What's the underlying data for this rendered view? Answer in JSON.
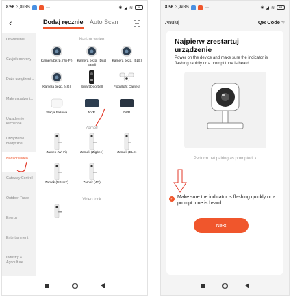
{
  "colors": {
    "accent": "#f0562c",
    "annotation_red": "#e33a2a"
  },
  "left": {
    "status": {
      "time": "8:56",
      "speed": "3,8kB/s",
      "more": "···",
      "battery": "68"
    },
    "header": {
      "back_icon": "chevron-left-icon",
      "tab_manual": "Dodaj ręcznie",
      "tab_auto": "Auto Scan",
      "scan_icon": "scan-frame-icon"
    },
    "sidebar": [
      {
        "label": "Oświetlenie"
      },
      {
        "label": "Czujnik ochrony"
      },
      {
        "label": "Duże urządzeni..."
      },
      {
        "label": "Małe urządzeni..."
      },
      {
        "label": "Urządzenie kuchenne"
      },
      {
        "label": "Urządzenie medyczne..."
      },
      {
        "label": "Nadzór wideo",
        "active": true
      },
      {
        "label": "Gateway Control"
      },
      {
        "label": "Outdoor Travel"
      },
      {
        "label": "Energy"
      },
      {
        "label": "Entertainment"
      },
      {
        "label": "Industry & Agriculture"
      }
    ],
    "sections": {
      "video": {
        "title": "Nadzór wideo",
        "items": [
          {
            "label": "Kamera bezp. (Wi-Fi)",
            "icon": "camera-icon"
          },
          {
            "label": "Kamera bezp. (Dual Band)",
            "icon": "camera-icon"
          },
          {
            "label": "Kamera bezp. (BLE)",
            "icon": "camera-icon"
          },
          {
            "label": "Kamera bezp. (4G)",
            "icon": "camera-icon"
          },
          {
            "label": "Smart Doorbell",
            "icon": "doorbell-icon"
          },
          {
            "label": "Floodlight Camera",
            "icon": "floodlight-icon"
          },
          {
            "label": "Stacja bazowa",
            "icon": "base-station-icon"
          },
          {
            "label": "NVR",
            "icon": "nvr-icon"
          },
          {
            "label": "DVR",
            "icon": "dvr-icon"
          }
        ]
      },
      "lock": {
        "title": "Zamek",
        "items": [
          {
            "label": "Zamek (Wi-Fi)",
            "icon": "lock-icon"
          },
          {
            "label": "Zamek (Zigbee)",
            "icon": "lock-icon"
          },
          {
            "label": "Zamek (BLE)",
            "icon": "lock-icon"
          },
          {
            "label": "Zamek (NB-IoT)",
            "icon": "lock-icon"
          },
          {
            "label": "Zamek (4G)",
            "icon": "lock-icon"
          }
        ]
      },
      "video_lock": {
        "title": "Video lock"
      }
    }
  },
  "right": {
    "status": {
      "time": "8:56",
      "speed": "3,9kB/s",
      "more": "···",
      "battery": "68"
    },
    "header": {
      "cancel": "Anuluj",
      "mode": "QR Code",
      "swap_icon": "swap-icon"
    },
    "title": "Najpierw zrestartuj urządzenie",
    "description": "Power on the device and make sure the indicator is flashing rapidly or a prompt tone is heard.",
    "pairing_link": "Perform net pairing as prompted.",
    "checkbox_label": "Make sure the indicator is flashing quickly or a prompt tone is heard",
    "checkbox_checked": true,
    "next_label": "Next"
  }
}
